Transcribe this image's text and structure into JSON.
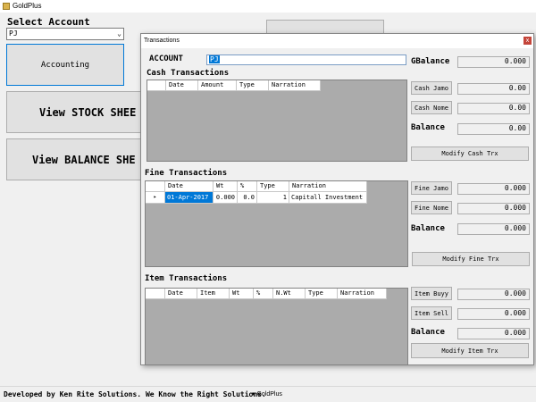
{
  "main": {
    "title": "GoldPlus",
    "select_account_label": "Select Account",
    "account_value": "PJ",
    "accounting_button": "Accounting",
    "stock_button": "View STOCK SHEE",
    "balance_button": "View BALANCE SHE",
    "footer_text": "Developed by Ken Rite Solutions. We Know the Right Solutions.",
    "footer_combo": "GoldPlus"
  },
  "dialog": {
    "title": "Transactions",
    "close_label": "x",
    "account_label": "ACCOUNT",
    "account_value": "PJ",
    "gbalance_label": "GBalance",
    "gbalance_value": "0.000",
    "cash": {
      "section_title": "Cash Transactions",
      "columns": [
        "Date",
        "Amount",
        "Type",
        "Narration"
      ],
      "jamo_label": "Cash Jamo",
      "jamo_value": "0.00",
      "nome_label": "Cash Nome",
      "nome_value": "0.00",
      "balance_label": "Balance",
      "balance_value": "0.00",
      "modify_label": "Modify Cash Trx"
    },
    "fine": {
      "section_title": "Fine Transactions",
      "columns": [
        "Date",
        "Wt",
        "%",
        "Type",
        "Narration"
      ],
      "rows": [
        {
          "indicator": "▸",
          "date": "01-Apr-2017",
          "wt": "0.000",
          "pct": "0.0",
          "type": "1",
          "narration": "Capitall Investment"
        }
      ],
      "jamo_label": "Fine Jamo",
      "jamo_value": "0.000",
      "nome_label": "Fine Nome",
      "nome_value": "0.000",
      "balance_label": "Balance",
      "balance_value": "0.000",
      "modify_label": "Modify Fine Trx"
    },
    "item": {
      "section_title": "Item Transactions",
      "columns": [
        "Date",
        "Item",
        "Wt",
        "%",
        "N.Wt",
        "Type",
        "Narration"
      ],
      "buy_label": "Item Buyy",
      "buy_value": "0.000",
      "sell_label": "Item Sell",
      "sell_value": "0.000",
      "balance_label": "Balance",
      "balance_value": "0.000",
      "modify_label": "Modify Item Trx"
    }
  },
  "colors": {
    "selection": "#0078d7",
    "grid_background": "#ababab",
    "window_background": "#f0f0f0",
    "close_button": "#c4453a"
  }
}
